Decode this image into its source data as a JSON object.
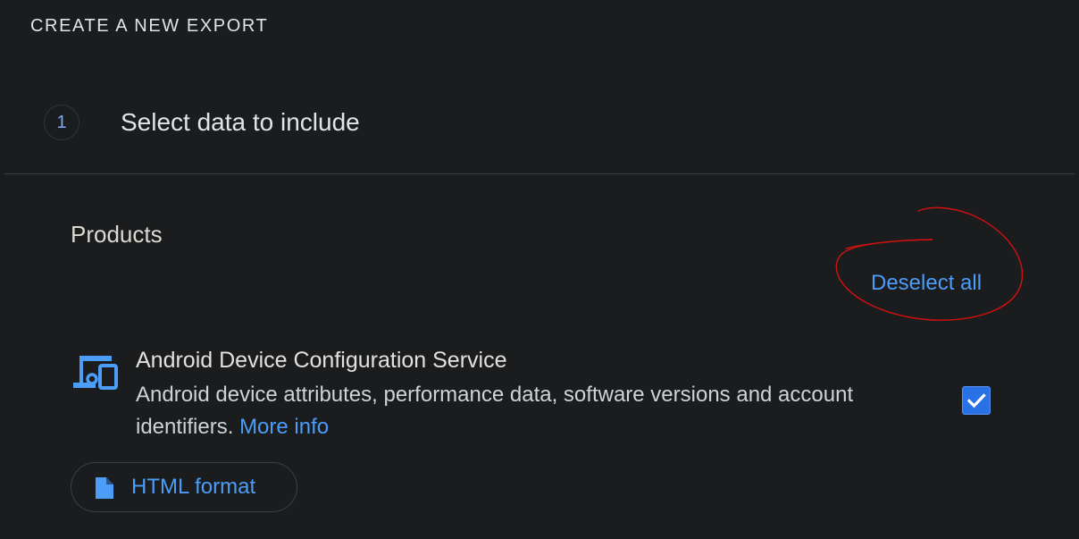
{
  "header": {
    "title": "CREATE A NEW EXPORT"
  },
  "step": {
    "number": "1",
    "title": "Select data to include"
  },
  "products": {
    "label": "Products",
    "deselect_label": "Deselect all",
    "items": [
      {
        "title": "Android Device Configuration Service",
        "description": "Android device attributes, performance data, software versions and account identifiers. ",
        "more_info_label": "More info",
        "checked": true,
        "icon": "devices-icon",
        "format_label": "HTML format",
        "format_icon": "file-icon"
      }
    ]
  },
  "colors": {
    "background": "#1b1c1e",
    "accent": "#4b9df8",
    "checkbox": "#2a71e8",
    "annotation": "#d41010"
  }
}
